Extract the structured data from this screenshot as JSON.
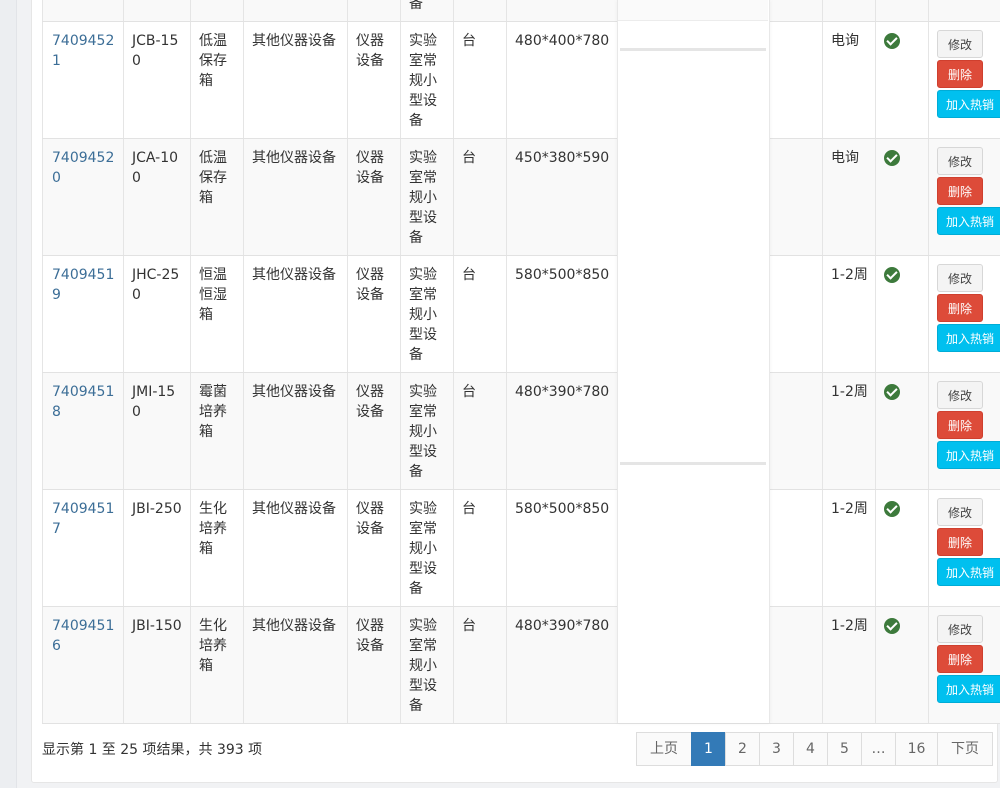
{
  "table": {
    "rows": [
      {
        "id": "74094521",
        "model": "JCB-150",
        "name": "低温保存箱",
        "category": "其他仪器设备",
        "type": "仪器设备",
        "subtype": "实验室常规小型设备",
        "unit": "台",
        "size": "480*400*780",
        "delivery": "电询"
      },
      {
        "id": "74094520",
        "model": "JCA-100",
        "name": "低温保存箱",
        "category": "其他仪器设备",
        "type": "仪器设备",
        "subtype": "实验室常规小型设备",
        "unit": "台",
        "size": "450*380*590",
        "delivery": "电询"
      },
      {
        "id": "74094519",
        "model": "JHC-250",
        "name": "恒温恒湿箱",
        "category": "其他仪器设备",
        "type": "仪器设备",
        "subtype": "实验室常规小型设备",
        "unit": "台",
        "size": "580*500*850",
        "delivery": "1-2周"
      },
      {
        "id": "74094518",
        "model": "JMI-150",
        "name": "霉菌培养箱",
        "category": "其他仪器设备",
        "type": "仪器设备",
        "subtype": "实验室常规小型设备",
        "unit": "台",
        "size": "480*390*780",
        "delivery": "1-2周"
      },
      {
        "id": "74094517",
        "model": "JBI-250",
        "name": "生化培养箱",
        "category": "其他仪器设备",
        "type": "仪器设备",
        "subtype": "实验室常规小型设备",
        "unit": "台",
        "size": "580*500*850",
        "delivery": "1-2周"
      },
      {
        "id": "74094516",
        "model": "JBI-150",
        "name": "生化培养箱",
        "category": "其他仪器设备",
        "type": "仪器设备",
        "subtype": "实验室常规小型设备",
        "unit": "台",
        "size": "480*390*780",
        "delivery": "1-2周"
      }
    ],
    "top_partial_text": "备",
    "actions": {
      "edit": "修改",
      "delete": "删除",
      "hot": "加入热销"
    }
  },
  "footer": {
    "info": "显示第 1 至 25 项结果，共 393 项",
    "pagination": [
      "上页",
      "1",
      "2",
      "3",
      "4",
      "5",
      "…",
      "16",
      "下页"
    ],
    "active_page": "1"
  },
  "colors": {
    "link": "#3c6e97",
    "check": "#3d7a3c",
    "danger": "#dd4b39",
    "info": "#00c0ef",
    "primary": "#337ab7"
  }
}
